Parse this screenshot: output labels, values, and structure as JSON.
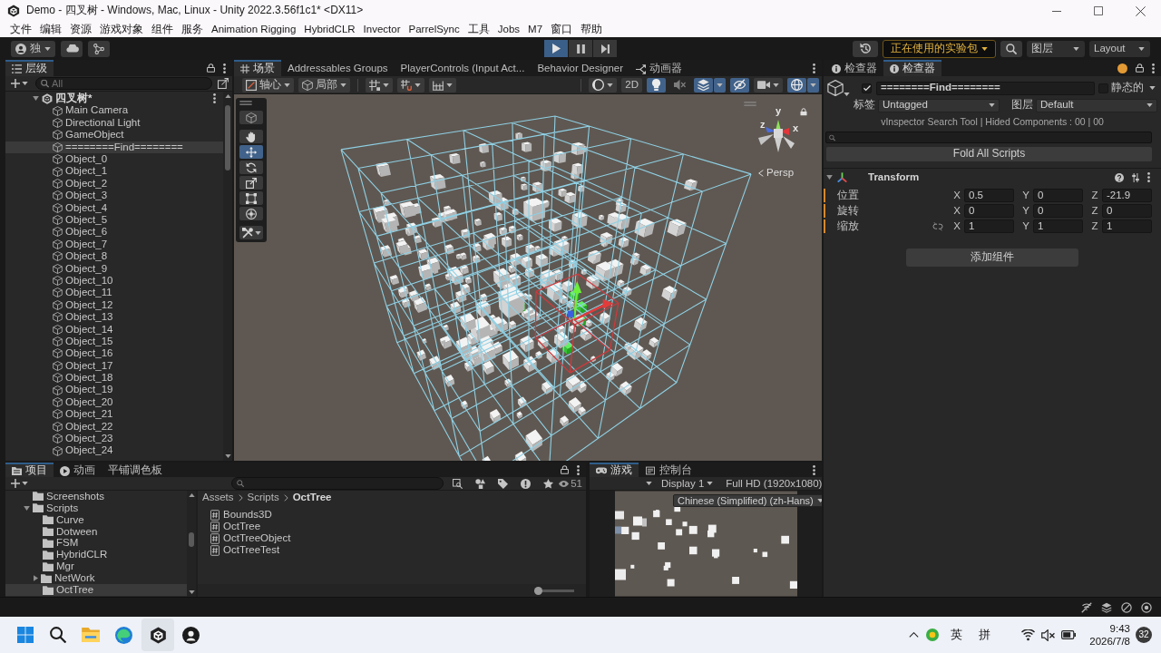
{
  "window": {
    "title": "Demo - 四叉树 - Windows, Mac, Linux - Unity 2022.3.56f1c1* <DX11>"
  },
  "menu_bar": [
    "文件",
    "编辑",
    "资源",
    "游戏对象",
    "组件",
    "服务",
    "Animation Rigging",
    "HybridCLR",
    "Invector",
    "ParrelSync",
    "工具",
    "Jobs",
    "M7",
    "窗口",
    "帮助"
  ],
  "toolbar": {
    "account": "独",
    "playing": true,
    "paused": false,
    "experimental_packages": "正在使用的实验包",
    "layers": "图层",
    "layout": "Layout"
  },
  "hierarchy": {
    "tabs": [
      {
        "label": "层级",
        "selected": true
      }
    ],
    "search": {
      "placeholder": "All"
    },
    "scene": {
      "name": "四叉树*",
      "selected": false,
      "expanded": true,
      "children": [
        {
          "name": "Main Camera",
          "selected": false
        },
        {
          "name": "Directional Light",
          "selected": false
        },
        {
          "name": "GameObject",
          "selected": false
        },
        {
          "name": "========Find========",
          "selected": true
        },
        {
          "name": "Object_0",
          "selected": false
        },
        {
          "name": "Object_1",
          "selected": false
        },
        {
          "name": "Object_2",
          "selected": false
        },
        {
          "name": "Object_3",
          "selected": false
        },
        {
          "name": "Object_4",
          "selected": false
        },
        {
          "name": "Object_5",
          "selected": false
        },
        {
          "name": "Object_6",
          "selected": false
        },
        {
          "name": "Object_7",
          "selected": false
        },
        {
          "name": "Object_8",
          "selected": false
        },
        {
          "name": "Object_9",
          "selected": false
        },
        {
          "name": "Object_10",
          "selected": false
        },
        {
          "name": "Object_11",
          "selected": false
        },
        {
          "name": "Object_12",
          "selected": false
        },
        {
          "name": "Object_13",
          "selected": false
        },
        {
          "name": "Object_14",
          "selected": false
        },
        {
          "name": "Object_15",
          "selected": false
        },
        {
          "name": "Object_16",
          "selected": false
        },
        {
          "name": "Object_17",
          "selected": false
        },
        {
          "name": "Object_18",
          "selected": false
        },
        {
          "name": "Object_19",
          "selected": false
        },
        {
          "name": "Object_20",
          "selected": false
        },
        {
          "name": "Object_21",
          "selected": false
        },
        {
          "name": "Object_22",
          "selected": false
        },
        {
          "name": "Object_23",
          "selected": false
        },
        {
          "name": "Object_24",
          "selected": false
        }
      ]
    }
  },
  "scene_panel": {
    "tabs": [
      {
        "label": "场景",
        "selected": true,
        "kind": "scene"
      },
      {
        "label": "Addressables Groups",
        "selected": false,
        "kind": "plain"
      },
      {
        "label": "PlayerControls (Input Act...",
        "selected": false,
        "kind": "plain"
      },
      {
        "label": "Behavior Designer",
        "selected": false,
        "kind": "plain"
      },
      {
        "label": "动画器",
        "selected": false,
        "kind": "animator"
      }
    ],
    "pivot": "轴心",
    "handle_space": "局部",
    "view_2d": {
      "label": "2D",
      "on": false
    },
    "view_toggles": [
      {
        "kind": "lighting",
        "on": true
      },
      {
        "kind": "audio",
        "on": false
      },
      {
        "kind": "effects",
        "on": true
      },
      {
        "kind": "visibility",
        "on": true
      },
      {
        "kind": "gizmos",
        "on": true
      }
    ],
    "tools": [
      {
        "kind": "view",
        "selected": false
      },
      {
        "kind": "hand",
        "selected": false
      },
      {
        "kind": "move",
        "selected": true
      },
      {
        "kind": "rotate",
        "selected": false
      },
      {
        "kind": "scale",
        "selected": false
      },
      {
        "kind": "rect",
        "selected": false
      },
      {
        "kind": "transform",
        "selected": false
      },
      {
        "kind": "custom",
        "selected": false
      }
    ],
    "gizmo_axes": [
      "y",
      "z",
      "x"
    ],
    "camera_mode": "Persp"
  },
  "inspector": {
    "tabs": [
      {
        "label": "检查器",
        "selected": false
      },
      {
        "label": "检查器",
        "selected": true
      }
    ],
    "object": {
      "active": true,
      "name": "========Find========",
      "static": false,
      "static_label": "静态的",
      "tag_label": "标签",
      "tag": "Untagged",
      "layer_label": "图层",
      "layer": "Default"
    },
    "search_tool_info": "vInspector Search Tool | Hided Components : 00 | 00",
    "fold_button": "Fold All Scripts",
    "component": {
      "name": "Transform",
      "expanded": true,
      "rows": [
        {
          "label": "位置",
          "modified": true,
          "fields": [
            {
              "axis": "X",
              "value": "0.5"
            },
            {
              "axis": "Y",
              "value": "0"
            },
            {
              "axis": "Z",
              "value": "-21.9"
            }
          ]
        },
        {
          "label": "旋转",
          "modified": true,
          "fields": [
            {
              "axis": "X",
              "value": "0"
            },
            {
              "axis": "Y",
              "value": "0"
            },
            {
              "axis": "Z",
              "value": "0"
            }
          ]
        },
        {
          "label": "缩放",
          "modified": true,
          "linked": false,
          "fields": [
            {
              "axis": "X",
              "value": "1"
            },
            {
              "axis": "Y",
              "value": "1"
            },
            {
              "axis": "Z",
              "value": "1"
            }
          ]
        }
      ]
    },
    "add_component": "添加组件"
  },
  "project_panel": {
    "tabs": [
      {
        "label": "项目",
        "selected": true,
        "kind": "project"
      },
      {
        "label": "动画",
        "selected": false,
        "kind": "animation"
      },
      {
        "label": "平铺调色板",
        "selected": false,
        "kind": "plain"
      }
    ],
    "hidden_count": "51",
    "folders": [
      {
        "name": "Screenshots",
        "selected": false
      },
      {
        "name": "Scripts",
        "selected": false,
        "expanded": true,
        "children": [
          {
            "name": "Curve",
            "selected": false
          },
          {
            "name": "Dotween",
            "selected": false
          },
          {
            "name": "FSM",
            "selected": false
          },
          {
            "name": "HybridCLR",
            "selected": false
          },
          {
            "name": "Mgr",
            "selected": false
          },
          {
            "name": "NetWork",
            "selected": false,
            "expanded": false
          },
          {
            "name": "OctTree",
            "selected": true
          }
        ]
      }
    ],
    "breadcrumb": [
      "Assets",
      "Scripts",
      "OctTree"
    ],
    "files": [
      "Bounds3D",
      "OctTree",
      "OctTreeObject",
      "OctTreeTest"
    ],
    "icon_size": {
      "level": 0.0
    }
  },
  "game_panel": {
    "tabs": [
      {
        "label": "游戏",
        "selected": true,
        "kind": "game"
      },
      {
        "label": "控制台",
        "selected": false,
        "kind": "console"
      }
    ],
    "display": "Display 1",
    "resolution": "Full HD (1920x1080)",
    "language": "Chinese (Simplified) (zh-Hans)"
  },
  "taskbar": {
    "input_language": "英",
    "input_method": "拼",
    "time": "9:43",
    "date": "2026/7/8",
    "notification_count": "32"
  }
}
